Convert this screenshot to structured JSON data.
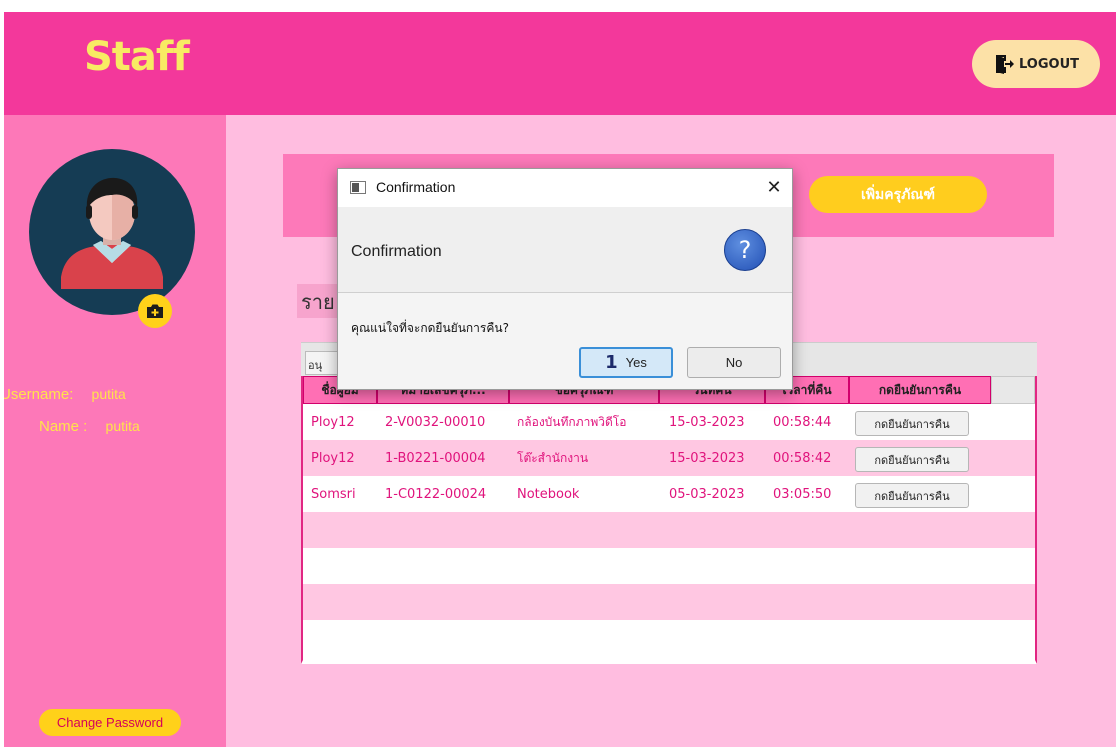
{
  "header": {
    "title": "Staff",
    "logout_label": "LOGOUT"
  },
  "sidebar": {
    "username_label": "Username:",
    "username_value": "putita",
    "name_label": "Name :",
    "name_value": "putita",
    "change_password_label": "Change Password"
  },
  "content": {
    "add_equipment_label": "เพิ่มครุภัณฑ์",
    "section_title": "ราย",
    "toolbar_tab": "อนุ"
  },
  "table": {
    "columns": [
      "ชื่อผู้ยืม",
      "หมายเลขครุภั...",
      "ชื่อครุภัณฑ์",
      "วันที่คืน",
      "เวลาที่คืน",
      "กดยืนยันการคืน"
    ],
    "rows": [
      {
        "borrower": "Ploy12",
        "number": "2-V0032-00010",
        "name": "กล้องบันทึกภาพวิดีโอ",
        "date": "15-03-2023",
        "time": "00:58:44",
        "action": "กดยืนยันการคืน"
      },
      {
        "borrower": "Ploy12",
        "number": "1-B0221-00004",
        "name": "โต๊ะสำนักงาน",
        "date": "15-03-2023",
        "time": "00:58:42",
        "action": "กดยืนยันการคืน"
      },
      {
        "borrower": "Somsri",
        "number": "1-C0122-00024",
        "name": "Notebook",
        "date": "05-03-2023",
        "time": "03:05:50",
        "action": "กดยืนยันการคืน"
      }
    ]
  },
  "dialog": {
    "window_title": "Confirmation",
    "close_glyph": "✕",
    "header_text": "Confirmation",
    "question_glyph": "?",
    "message": "คุณแน่ใจที่จะกดยืนยันการคืน?",
    "yes_marker": "1",
    "yes_label": "Yes",
    "no_label": "No"
  },
  "colors": {
    "header_bg": "#f3389b",
    "sidebar_bg": "#fd78b8",
    "content_bg": "#ffbde0",
    "accent_yellow": "#ffd11a",
    "title_yellow": "#f8eb63",
    "row_text": "#e0137c"
  },
  "icons": [
    "logout-icon",
    "user-avatar-icon",
    "camera-add-icon",
    "window-app-icon",
    "close-icon",
    "question-icon"
  ]
}
